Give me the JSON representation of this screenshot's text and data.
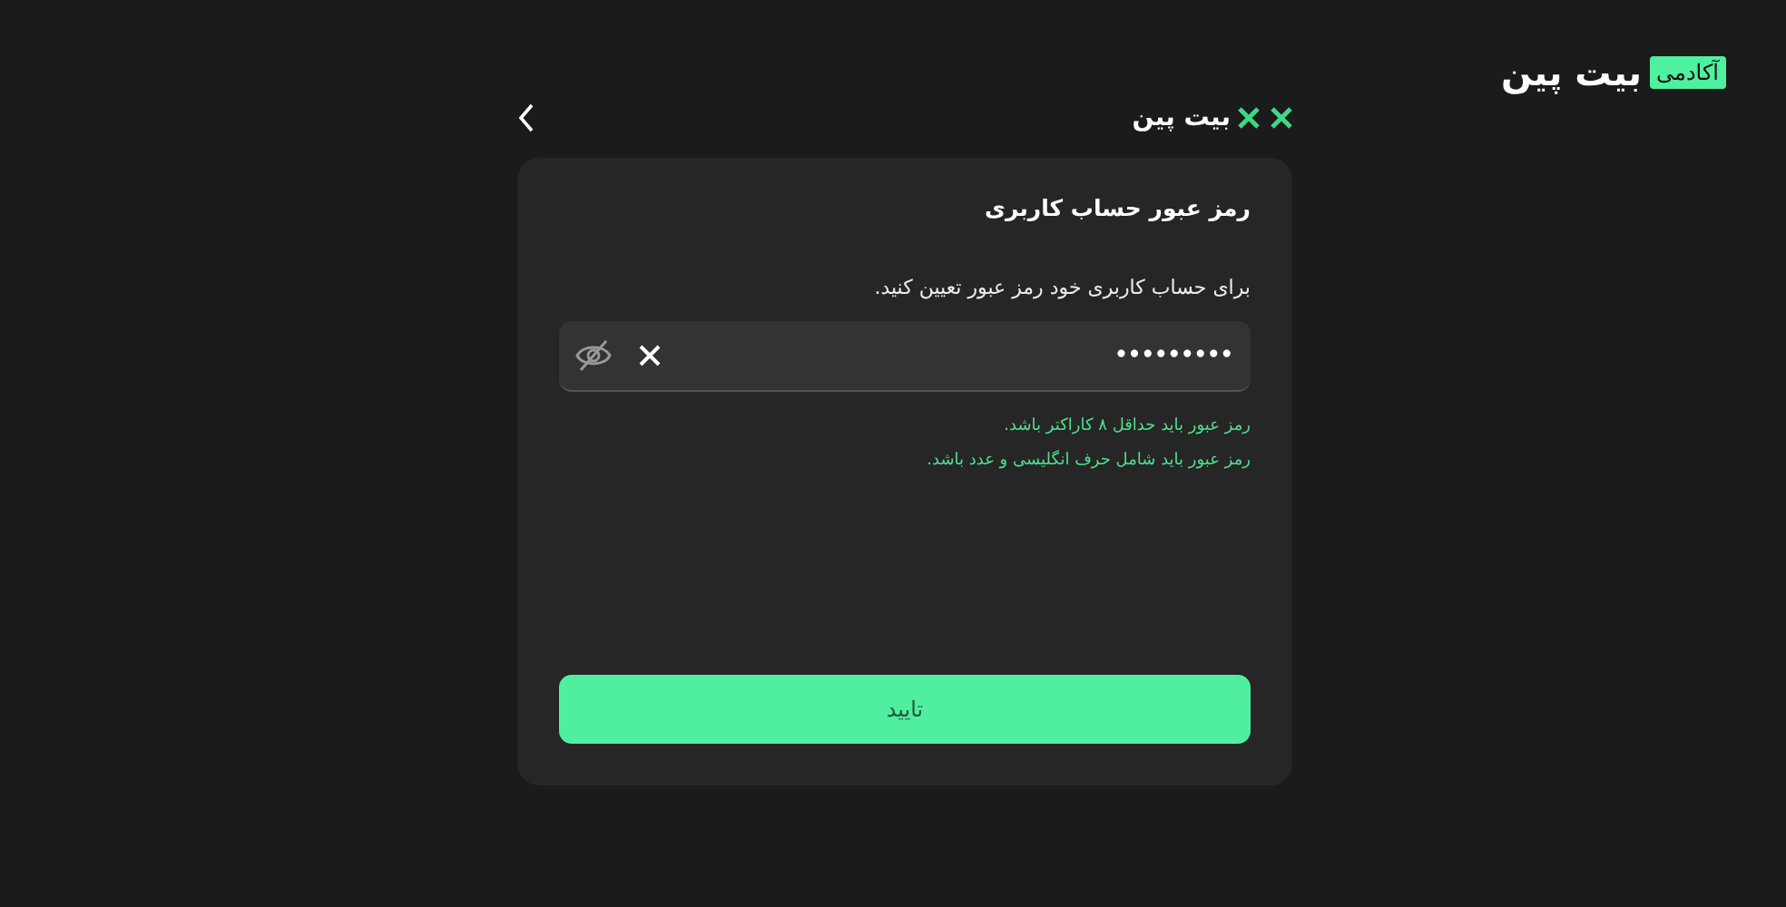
{
  "site_logo": {
    "name": "بیت پین",
    "badge": "آکادمی"
  },
  "card_header": {
    "logo": "بیت پین"
  },
  "card": {
    "title": "رمز عبور حساب کاربری",
    "instruction": "برای حساب کاربری خود رمز عبور تعیین کنید.",
    "password_field": {
      "value": "•••••••••"
    },
    "rules": [
      "رمز عبور باید حداقل ۸ کاراکتر باشد.",
      "رمز عبور باید شامل حرف انگلیسی و عدد باشد."
    ],
    "submit_button": "تایید"
  }
}
